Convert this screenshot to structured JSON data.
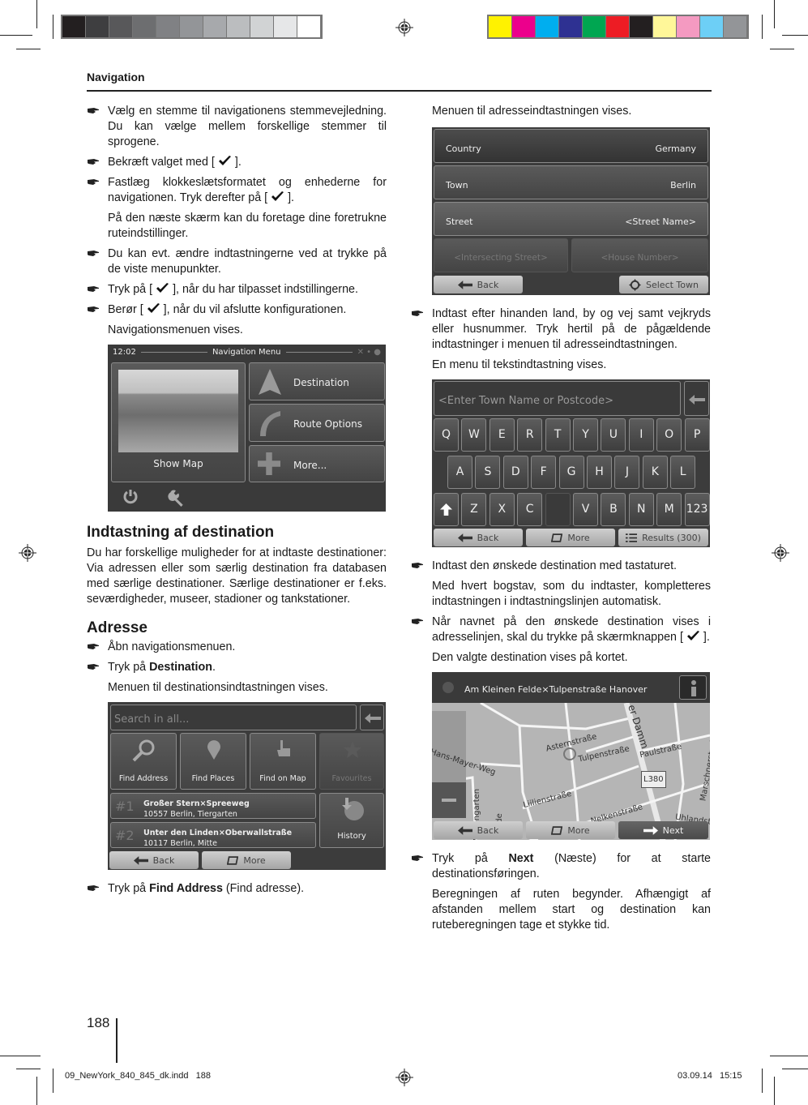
{
  "print_marks": {
    "gray_swatches": [
      "#231f20",
      "#3e3e40",
      "#58585a",
      "#6d6e70",
      "#808184",
      "#939598",
      "#a7a9ac",
      "#bbbdbf",
      "#d1d3d4",
      "#e6e7e8",
      "#ffffff"
    ],
    "color_swatches": [
      "#fff200",
      "#ec008c",
      "#00aeef",
      "#2e3192",
      "#00a651",
      "#ed1c24",
      "#231f20",
      "#fff799",
      "#f49ac1",
      "#6dcff6",
      "#939598"
    ]
  },
  "header": {
    "section_title": "Navigation"
  },
  "left_column": {
    "steps_intro": [
      {
        "type": "step",
        "text": "Vælg en stemme til navigationens stemmevejledning. Du kan vælge mellem forskellige stemmer til sprogene."
      },
      {
        "type": "step",
        "text_before": "Bekræft valget med [",
        "text_after": "]."
      },
      {
        "type": "step",
        "text_before": "Fastlæg klokkeslætsformatet og enhederne for navigationen. Tryk derefter på [",
        "text_after": "]."
      },
      {
        "type": "para",
        "text": "På den næste skærm kan du foretage dine foretrukne ruteindstillinger."
      },
      {
        "type": "step",
        "text": "Du kan evt. ændre indtastningerne ved at trykke på de viste menupunkter."
      },
      {
        "type": "step",
        "text_before": "Tryk på [",
        "text_after": "], når du har tilpasset indstillingerne."
      },
      {
        "type": "step",
        "text_before": "Berør [",
        "text_after": "], når du vil afslutte konfigurationen."
      },
      {
        "type": "para",
        "text": "Navigationsmenuen vises."
      }
    ],
    "nav_menu_screen": {
      "time": "12:02",
      "title": "Navigation Menu",
      "show_map_label": "Show Map",
      "items": [
        "Destination",
        "Route Options",
        "More..."
      ]
    },
    "section_heading": "Indtastning af destination",
    "section_body": "Du har forskellige muligheder for at indtaste destinationer: Via adressen eller som særlig destination fra databasen med særlige destinationer. Særlige destinationer er f.eks. seværdigheder, museer, stadioner og tankstationer.",
    "subheading": "Adresse",
    "address_steps": {
      "open_menu": "Åbn navigationsmenuen.",
      "tap_prefix": "Tryk på ",
      "tap_destination_bold": "Destination",
      "tap_suffix": ".",
      "result": "Menuen til destinationsindtastningen vises."
    },
    "destination_screen": {
      "search_placeholder": "Search in all...",
      "tiles": [
        "Find Address",
        "Find Places",
        "Find on Map",
        "Favourites"
      ],
      "recent": [
        {
          "rank": "#1",
          "title": "Großer Stern×Spreeweg",
          "subtitle": "10557 Berlin, Tiergarten"
        },
        {
          "rank": "#2",
          "title": "Unter den Linden×Oberwallstraße",
          "subtitle": "10117 Berlin, Mitte"
        }
      ],
      "history_label": "History",
      "back_label": "Back",
      "more_label": "More"
    },
    "final_step": {
      "prefix": "Tryk på ",
      "bold": "Find Address",
      "suffix": " (Find adresse)."
    }
  },
  "right_column": {
    "intro": "Menuen til adresseindtastningen vises.",
    "address_screen": {
      "rows": [
        {
          "label": "Country",
          "value": "Germany"
        },
        {
          "label": "Town",
          "value": "Berlin"
        },
        {
          "label": "Street",
          "value": "<Street Name>"
        }
      ],
      "intersecting_placeholder": "<Intersecting Street>",
      "house_number_placeholder": "<House Number>",
      "back_label": "Back",
      "select_town_label": "Select Town"
    },
    "step_enter": "Indtast efter hinanden land, by og vej samt vejkryds eller husnummer. Tryk hertil på de pågældende indtastninger i menuen til adresseindtastningen.",
    "text_menu_appears": "En menu til tekstindtastning vises.",
    "keyboard_screen": {
      "input_placeholder": "<Enter Town Name or Postcode>",
      "row1": [
        "Q",
        "W",
        "E",
        "R",
        "T",
        "Y",
        "U",
        "I",
        "O",
        "P"
      ],
      "row2": [
        "A",
        "S",
        "D",
        "F",
        "G",
        "H",
        "J",
        "K",
        "L"
      ],
      "row3": [
        "Z",
        "X",
        "C",
        "",
        "V",
        "B",
        "N",
        "M",
        "123"
      ],
      "back_label": "Back",
      "more_label": "More",
      "results_label": "Results (300)"
    },
    "step_type": "Indtast den ønskede destination med tastaturet.",
    "autocomplete_note": "Med hvert bogstav, som du indtaster, kompletteres indtastningen i indtastningslinjen automatisk.",
    "step_confirm_before": "Når navnet på den ønskede destination vises i adresselinjen, skal du trykke på skærmknappen [",
    "step_confirm_after": "].",
    "map_note": "Den valgte destination vises på kortet.",
    "map_screen": {
      "address": "Am Kleinen Felde×Tulpenstraße Hanover",
      "streets": [
        "Asternstraße",
        "Tulpenstraße",
        "Paulstraße",
        "Hans-Mayer-Weg",
        "Liilienstraße",
        "Nelkenstraße",
        "Welfengarten",
        "Felde",
        "Uhlandstr",
        "L380",
        "er Damm",
        "Marschnerstraße"
      ],
      "back_label": "Back",
      "more_label": "More",
      "next_label": "Next"
    },
    "step_next": {
      "prefix": "Tryk på ",
      "bold": "Next",
      "suffix": " (Næste) for at starte destinationsføringen."
    },
    "calc_note": "Beregningen af ruten begynder. Afhængigt af afstanden mellem start og destination kan ruteberegningen tage et stykke tid."
  },
  "footer": {
    "page_number": "188",
    "file_slug": "09_NewYork_840_845_dk.indd   188",
    "date_slug": "03.09.14   15:15"
  }
}
